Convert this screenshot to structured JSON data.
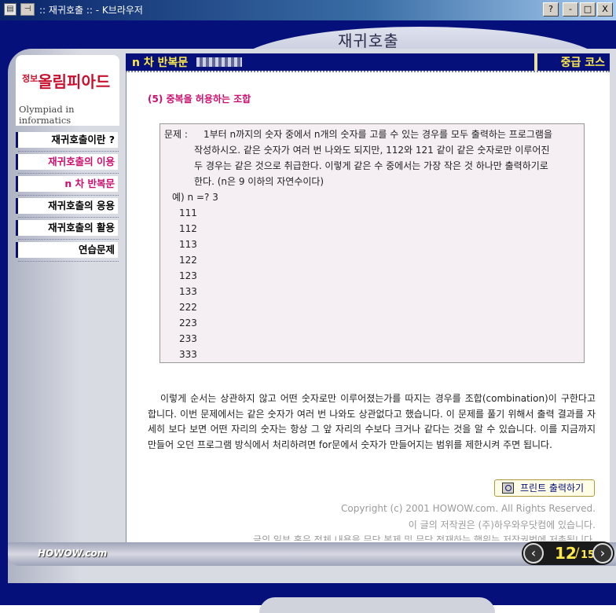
{
  "window": {
    "title": ":: 재귀호출 :: - K브라우저",
    "help_glyph": "?",
    "minimize_glyph": "-",
    "maximize_glyph": "□",
    "close_glyph": "X"
  },
  "header": {
    "page_heading": "재귀호출"
  },
  "sidebar": {
    "logo_small": "정보",
    "logo_main": "올림피아드",
    "logo_sub": "Olympiad in informatics",
    "items": [
      {
        "label": "재귀호출이란 ?"
      },
      {
        "label": "재귀호출의 이용"
      },
      {
        "label": "n 차 반복문"
      },
      {
        "label": "재귀호출의 응용"
      },
      {
        "label": "재귀호출의 활용"
      },
      {
        "label": "연습문제"
      }
    ]
  },
  "navbar": {
    "section": "n 차 반복문",
    "level": "중급 코스"
  },
  "content": {
    "section_title": "(5) 중복을 허용하는 조합",
    "problem_label": "문제 :",
    "problem_lines": [
      "1부터 n까지의 숫자 중에서 n개의 숫자를 고를 수 있는 경우를 모두 출력하는 프로그램을",
      "작성하시오. 같은 숫자가 여러 번 나와도 되지만, 112와 121 같이 같은 숫자로만 이루어진",
      "두 경우는 같은 것으로 취급한다. 이렇게 같은 수 중에서는 가장 작은 것 하나만 출력하기로",
      "한다. (n은 9 이하의 자연수이다)"
    ],
    "example": "예) n =? 3",
    "answers": [
      "111",
      "112",
      "113",
      "122",
      "123",
      "133",
      "222",
      "223",
      "233",
      "333"
    ],
    "explanation": "이렇게 순서는 상관하지 않고 어떤 숫자로만 이루어졌는가를 따지는 경우를 조합(combination)이 구한다고 합니다. 이번 문제에서는 같은 숫자가 여러 번 나와도 상관없다고 했습니다. 이 문제를 풀기 위해서 출력 결과를 자세히 보다 보면 어떤 자리의 숫자는 항상 그 앞 자리의 수보다 크거나 같다는 것을 알 수 있습니다. 이를 지금까지 만들어 오던 프로그램 방식에서 처리하려면 for문에서 숫자가 만들어지는 범위를 제한시켜 주면 됩니다.",
    "print_button": "프린트 출력하기",
    "copyright_lines": [
      "Copyright (c) 2001 HOWOW.com. All Rights Reserved.",
      "이 글의 저작권은 (주)하우와우닷컴에 있습니다.",
      "글의 일부 혹은 전체 내용을 무단 복제 및 무단 전재하는 행위는 저작권법에 저촉됩니다."
    ]
  },
  "footer": {
    "logo": "HOWOW.com",
    "current_page": "12",
    "separator": "/",
    "total_pages": "15",
    "prev_glyph": "‹",
    "next_glyph": "›"
  }
}
